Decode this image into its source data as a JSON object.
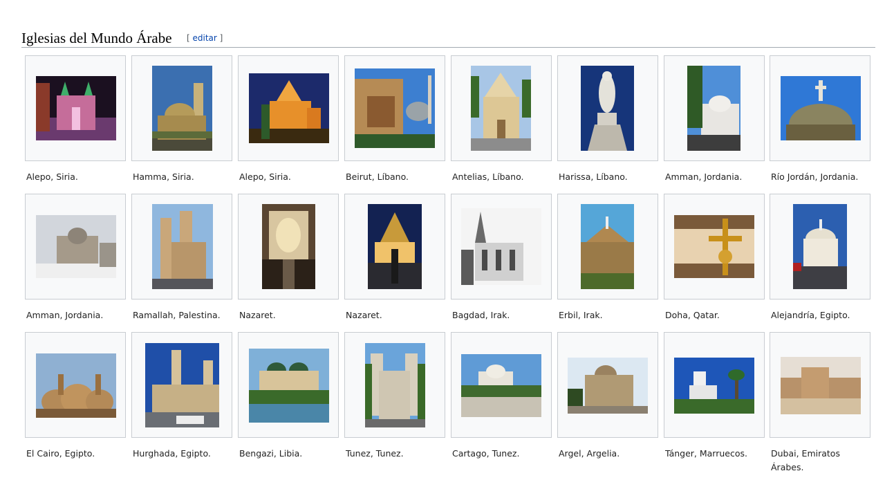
{
  "section": {
    "title": "Iglesias del Mundo Árabe",
    "edit_open": "[",
    "edit_label": "editar",
    "edit_close": "]"
  },
  "gallery": [
    {
      "caption": "Alepo, Siria."
    },
    {
      "caption": "Hamma, Siria."
    },
    {
      "caption": "Alepo, Siria."
    },
    {
      "caption": "Beirut, Líbano."
    },
    {
      "caption": "Antelias, Líbano."
    },
    {
      "caption": "Harissa, Líbano."
    },
    {
      "caption": "Amman, Jordania."
    },
    {
      "caption": "Río Jordán, Jordania."
    },
    {
      "caption": "Amman, Jordania."
    },
    {
      "caption": "Ramallah, Palestina."
    },
    {
      "caption": "Nazaret."
    },
    {
      "caption": "Nazaret."
    },
    {
      "caption": "Bagdad, Irak."
    },
    {
      "caption": "Erbil, Irak."
    },
    {
      "caption": "Doha, Qatar."
    },
    {
      "caption": "Alejandría, Egipto."
    },
    {
      "caption": "El Cairo, Egipto."
    },
    {
      "caption": "Hurghada, Egipto."
    },
    {
      "caption": "Bengazi, Libia."
    },
    {
      "caption": "Tunez, Tunez."
    },
    {
      "caption": "Cartago, Tunez."
    },
    {
      "caption": "Argel, Argelia."
    },
    {
      "caption": "Tánger, Marruecos."
    },
    {
      "caption": "Dubai, Emiratos Árabes."
    }
  ]
}
